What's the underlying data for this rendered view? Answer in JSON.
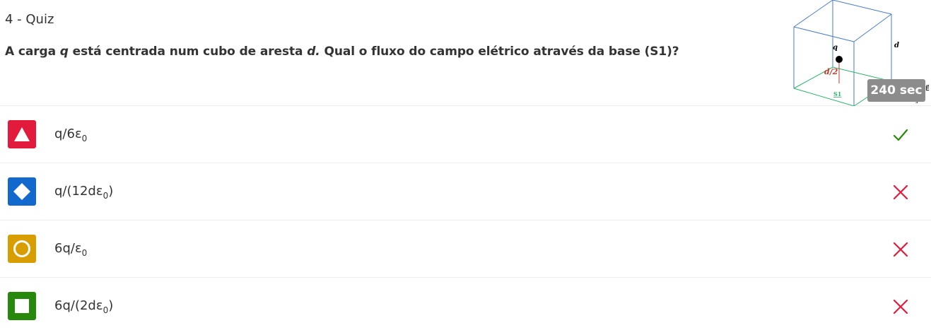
{
  "header": {
    "quiz_label": "4 - Quiz",
    "question": {
      "part1": "A carga ",
      "var_q": "q",
      "part2": " está centrada num cubo de aresta ",
      "var_d": "d.",
      "part3": " Qual o fluxo do campo elétrico através da base (S1)?"
    },
    "timer": "240 sec"
  },
  "figure": {
    "label_q": "q",
    "label_d": "d",
    "label_half_d": "d/2",
    "label_s1": "S1",
    "label_e": "E⃗",
    "label_s": "s",
    "cube_color": "#4a7cc7",
    "base_color": "#2db36b",
    "dimension_color": "#c0392b"
  },
  "options": [
    {
      "main": "q/6ε",
      "sub": "0",
      "tail": "",
      "shape": "triangle-icon",
      "color": "#e21b3c",
      "result": "correct"
    },
    {
      "main": "q/(12dε",
      "sub": "0",
      "tail": ")",
      "shape": "diamond-icon",
      "color": "#1368ce",
      "result": "incorrect"
    },
    {
      "main": "6q/ε",
      "sub": "0",
      "tail": "",
      "shape": "circle-icon",
      "color": "#d89e00",
      "result": "incorrect"
    },
    {
      "main": "6q/(2dε",
      "sub": "0",
      "tail": ")",
      "shape": "square-icon",
      "color": "#26890c",
      "result": "incorrect"
    }
  ],
  "colors": {
    "correct": "#26890c",
    "incorrect": "#e21b3c",
    "timer_bg": "#8c8c8c"
  }
}
